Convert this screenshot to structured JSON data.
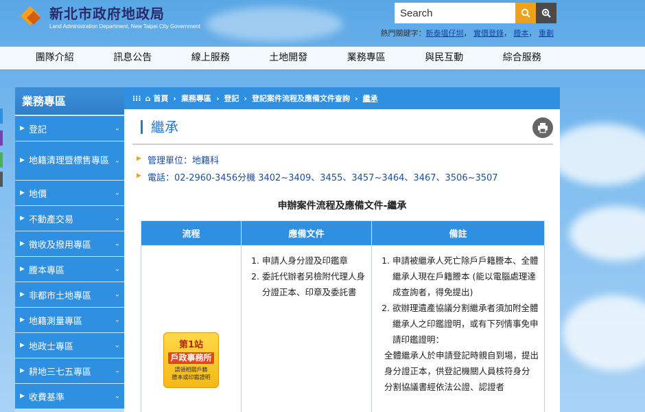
{
  "header": {
    "site_title": "新北市政府地政局",
    "site_subtitle": "Land Administration Department, New Taipei City Government",
    "search_placeholder": "Search",
    "hotkeys_label": "熱門關鍵字：",
    "hotkeys": [
      "新泰塭仔圳",
      "實價登錄",
      "謄本",
      "重劃"
    ]
  },
  "nav": [
    "團隊介紹",
    "訊息公告",
    "線上服務",
    "土地開發",
    "業務專區",
    "與民互動",
    "綜合服務"
  ],
  "sidebar": {
    "title": "業務專區",
    "items": [
      "登記",
      "地籍清理暨標售專區",
      "地價",
      "不動產交易",
      "徵收及撥用專區",
      "謄本專區",
      "非都市土地專區",
      "地籍測量專區",
      "地政士專區",
      "耕地三七五專區",
      "收費基準"
    ]
  },
  "breadcrumb": [
    "首頁",
    "業務專區",
    "登記",
    "登記案件流程及應備文件查詢",
    "繼承"
  ],
  "page": {
    "title": "繼承",
    "manager": "管理單位：地籍科",
    "phone": "電話：02-2960-3456分機 3402~3409、3455、3457~3464、3467、3506~3507",
    "subtitle": "申辦案件流程及應備文件-繼承"
  },
  "table": {
    "headers": [
      "流程",
      "應備文件",
      "備註"
    ],
    "station": {
      "number": "第1站",
      "name": "戶政事務所",
      "desc_line1": "請領相關戶籍",
      "desc_line2": "謄本或印鑑證明"
    },
    "documents": [
      "申請人身分證及印鑑章",
      "委託代辦者另檢附代理人身分證正本、印章及委託書"
    ],
    "notes": [
      "申請被繼承人死亡除戶戶籍謄本、全體繼承人現在戶籍謄本 (能以電腦處理達成查詢者，得免提出)",
      "欲辦理遺產協議分割繼承者須加附全體繼承人之印鑑證明，或有下列情事免申請印鑑證明："
    ],
    "note_extra1": "全體繼承人於申請登記時親自到場，提出身分證正本，供登記機關人員核符身分",
    "note_extra2": "分割協議書經依法公證、認證者"
  }
}
